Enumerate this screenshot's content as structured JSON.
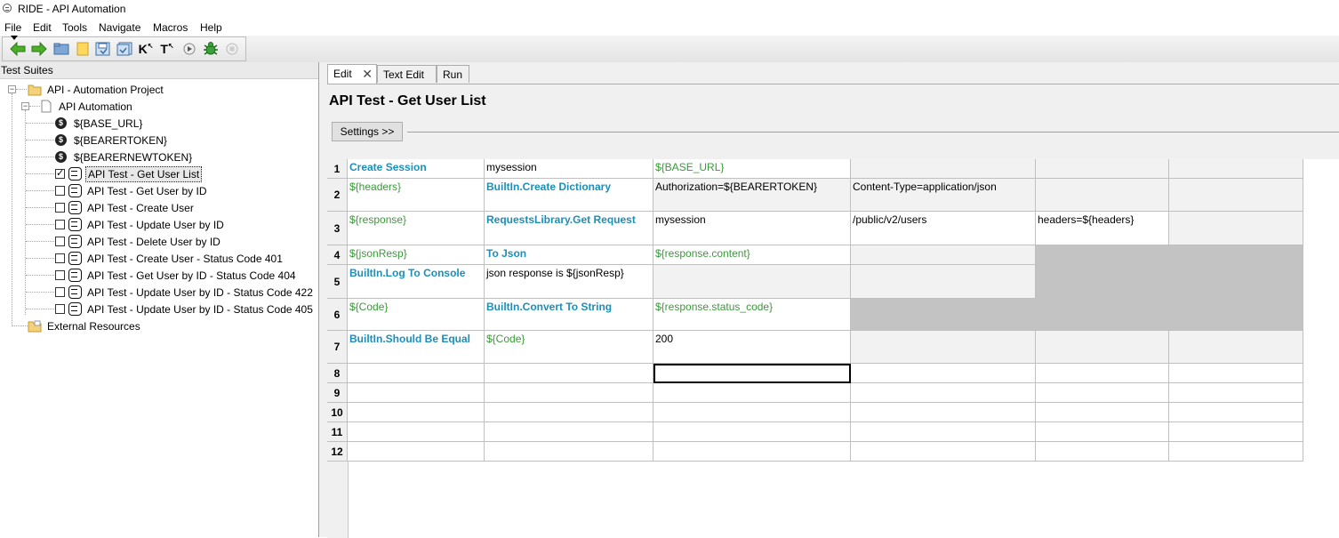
{
  "window": {
    "title": "RIDE - API Automation"
  },
  "menu": [
    "File",
    "Edit",
    "Tools",
    "Navigate",
    "Macros",
    "Help"
  ],
  "toolbar": {
    "icons": [
      "back-arrow-icon",
      "forward-arrow-icon",
      "open-folder-icon",
      "new-folder-icon",
      "save-icon",
      "save-all-icon",
      "search-keywords-icon",
      "search-tests-icon",
      "run-icon",
      "debug-bug-icon",
      "stop-icon"
    ],
    "k_label": "K",
    "t_label": "T"
  },
  "tree": {
    "header": "Test Suites",
    "project": "API - Automation Project",
    "suite": "API Automation",
    "variables": [
      "${BASE_URL}",
      "${BEARERTOKEN}",
      "${BEARERNEWTOKEN}"
    ],
    "tests": [
      {
        "label": "API Test - Get User List",
        "checked": true
      },
      {
        "label": "API Test - Get User by ID",
        "checked": false
      },
      {
        "label": "API Test - Create User",
        "checked": false
      },
      {
        "label": "API Test - Update User by ID",
        "checked": false
      },
      {
        "label": "API Test - Delete User by ID",
        "checked": false
      },
      {
        "label": "API Test - Create User - Status Code 401",
        "checked": false
      },
      {
        "label": "API Test - Get User by ID - Status Code 404",
        "checked": false
      },
      {
        "label": "API Test - Update User by ID - Status Code 422",
        "checked": false
      },
      {
        "label": "API Test - Update User by ID - Status Code 405",
        "checked": false
      }
    ],
    "external": "External Resources"
  },
  "tabs": [
    "Edit",
    "Text Edit",
    "Run"
  ],
  "editor": {
    "test_name": "API Test - Get User List",
    "settings_label": "Settings >>",
    "rows": [
      {
        "num": "1",
        "cells": [
          "Create Session",
          "mysession",
          "${BASE_URL}",
          "",
          "",
          ""
        ]
      },
      {
        "num": "2",
        "cells": [
          "${headers}",
          "BuiltIn.Create Dictionary",
          "Authorization=${BEARERTOKEN}",
          "Content-Type=application/json",
          "",
          ""
        ]
      },
      {
        "num": "3",
        "cells": [
          "${response}",
          "RequestsLibrary.Get Request",
          "mysession",
          "/public/v2/users",
          "headers=${headers}",
          ""
        ]
      },
      {
        "num": "4",
        "cells": [
          "${jsonResp}",
          "To Json",
          "${response.content}",
          "",
          "",
          ""
        ]
      },
      {
        "num": "5",
        "cells": [
          "BuiltIn.Log To Console",
          "json response is ${jsonResp}",
          "",
          "",
          "",
          ""
        ]
      },
      {
        "num": "6",
        "cells": [
          "${Code}",
          "BuiltIn.Convert To String",
          "${response.status_code}",
          "",
          "",
          ""
        ]
      },
      {
        "num": "7",
        "cells": [
          "BuiltIn.Should Be Equal",
          "${Code}",
          "200",
          "",
          "",
          ""
        ]
      },
      {
        "num": "8",
        "cells": [
          "",
          "",
          "",
          "",
          "",
          ""
        ]
      },
      {
        "num": "9",
        "cells": [
          "",
          "",
          "",
          "",
          "",
          ""
        ]
      },
      {
        "num": "10",
        "cells": [
          "",
          "",
          "",
          "",
          "",
          ""
        ]
      },
      {
        "num": "11",
        "cells": [
          "",
          "",
          "",
          "",
          "",
          ""
        ]
      },
      {
        "num": "12",
        "cells": [
          "",
          "",
          "",
          "",
          "",
          ""
        ]
      }
    ]
  }
}
